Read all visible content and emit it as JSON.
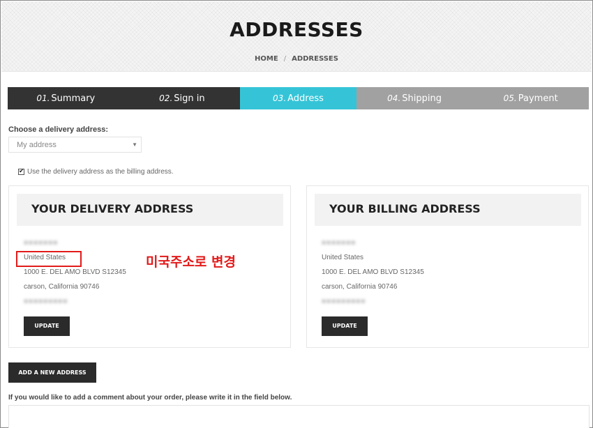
{
  "header": {
    "title": "ADDRESSES",
    "breadcrumb": {
      "home": "HOME",
      "separator": "/",
      "current": "ADDRESSES"
    }
  },
  "steps": [
    {
      "num": "01.",
      "label": "Summary",
      "state": "done"
    },
    {
      "num": "02.",
      "label": "Sign in",
      "state": "done"
    },
    {
      "num": "03.",
      "label": "Address",
      "state": "current"
    },
    {
      "num": "04.",
      "label": "Shipping",
      "state": "todo"
    },
    {
      "num": "05.",
      "label": "Payment",
      "state": "todo"
    }
  ],
  "colors": {
    "step_done": "#333333",
    "step_current": "#35c4d7",
    "step_todo": "#a1a1a1",
    "annotation": "#e21a1a"
  },
  "delivery_select": {
    "label": "Choose a delivery address:",
    "value": "My address"
  },
  "billing_checkbox": {
    "label": "Use the delivery address as the billing address.",
    "checked": true
  },
  "delivery_card": {
    "title": "YOUR DELIVERY ADDRESS",
    "name_blurred": "■■■■■■■",
    "country": "United States",
    "street": "1000 E. DEL AMO BLVD S12345",
    "city": "carson, California 90746",
    "phone_blurred": "■■■■■■■■■",
    "update_label": "UPDATE"
  },
  "billing_card": {
    "title": "YOUR BILLING ADDRESS",
    "name_blurred": "■■■■■■■",
    "country": "United States",
    "street": "1000 E. DEL AMO BLVD S12345",
    "city": "carson, California 90746",
    "phone_blurred": "■■■■■■■■■",
    "update_label": "UPDATE"
  },
  "annotation": {
    "text": "미국주소로 변경"
  },
  "add_address_label": "ADD A NEW ADDRESS",
  "comment": {
    "label": "If you would like to add a comment about your order, please write it in the field below.",
    "value": ""
  }
}
